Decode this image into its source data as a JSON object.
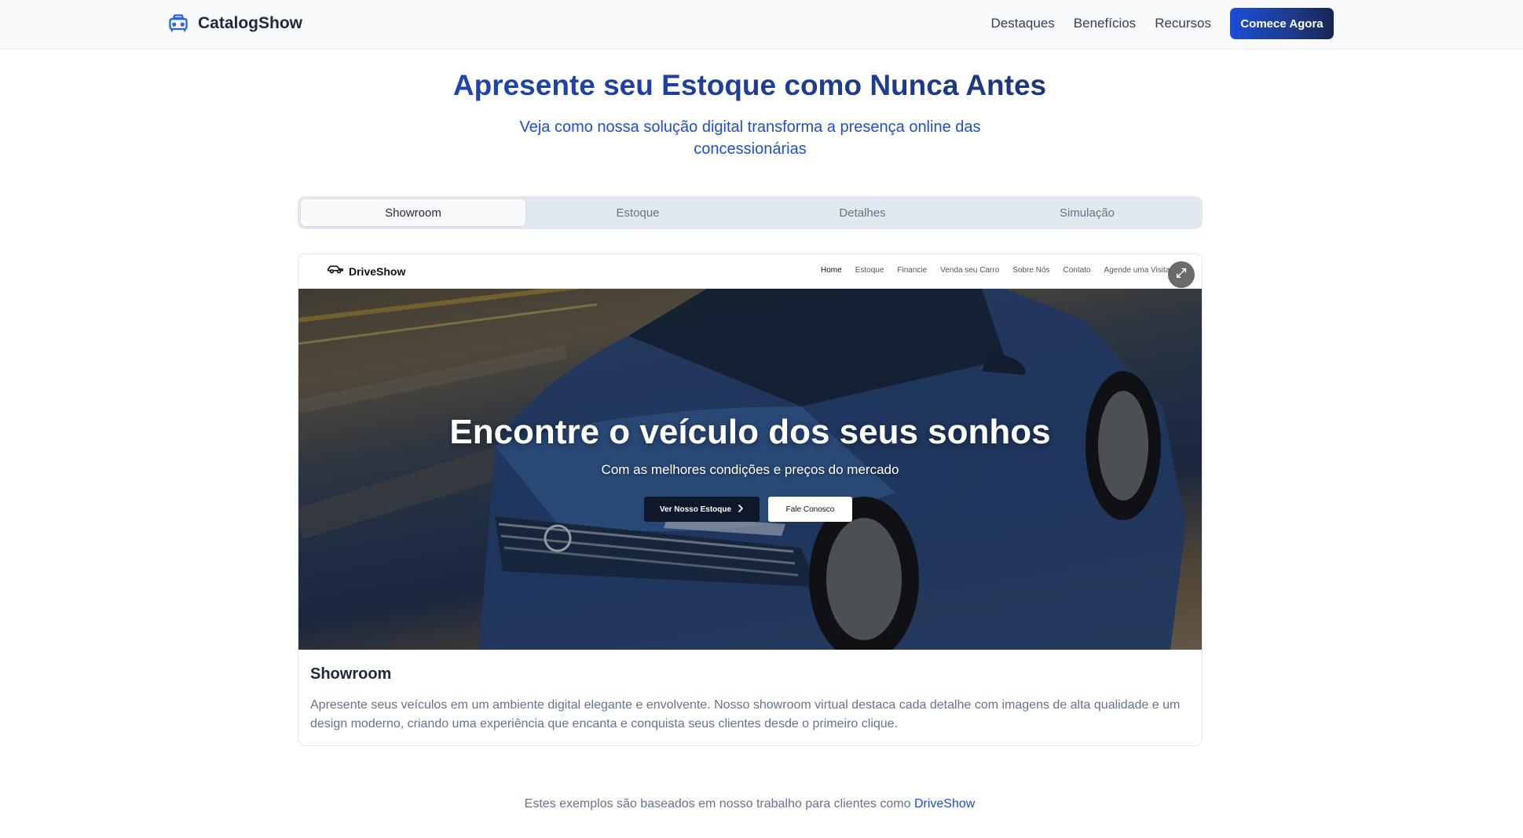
{
  "navbar": {
    "brand": "CatalogShow",
    "links": [
      "Destaques",
      "Benefícios",
      "Recursos"
    ],
    "cta": "Comece Agora"
  },
  "hero": {
    "title": "Apresente seu Estoque como Nunca Antes",
    "subtitle": "Veja como nossa solução digital transforma a presença online das concessionárias"
  },
  "tabs": [
    "Showroom",
    "Estoque",
    "Detalhes",
    "Simulação"
  ],
  "active_tab": "Showroom",
  "preview": {
    "site_brand": "DriveShow",
    "site_links": [
      "Home",
      "Estoque",
      "Financie",
      "Venda seu Carro",
      "Sobre Nós",
      "Contato",
      "Agende uma Visita"
    ],
    "headline": "Encontre o veículo dos seus sonhos",
    "subheadline": "Com as melhores condições e preços do mercado",
    "primary_button": "Ver Nosso Estoque",
    "secondary_button": "Fale Conosco"
  },
  "card": {
    "title": "Showroom",
    "description": "Apresente seus veículos em um ambiente digital elegante e envolvente. Nosso showroom virtual destaca cada detalhe com imagens de alta qualidade e um design moderno, criando uma experiência que encanta e conquista seus clientes desde o primeiro clique."
  },
  "footer": {
    "note": "Estes exemplos são baseados em nosso trabalho para clientes como",
    "link": "DriveShow"
  },
  "colors": {
    "accent": "#1d4ed8",
    "accent_dark": "#172554",
    "muted_text": "#64748b"
  },
  "icons": {
    "brand": "car-front-icon",
    "preview_brand": "car-side-icon",
    "expand": "expand-icon",
    "chevron": "chevron-right-icon"
  }
}
